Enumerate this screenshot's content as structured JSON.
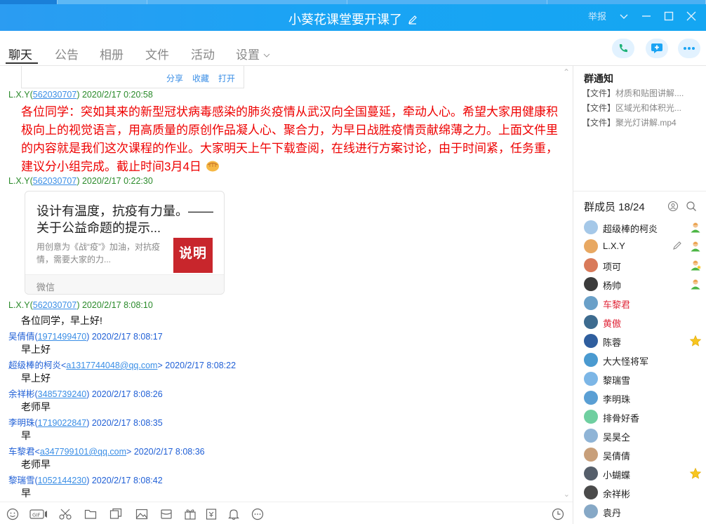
{
  "window": {
    "title": "小葵花课堂要开课了",
    "report_label": "举报"
  },
  "tabs": [
    {
      "label": "聊天",
      "active": true
    },
    {
      "label": "公告"
    },
    {
      "label": "相册"
    },
    {
      "label": "文件"
    },
    {
      "label": "活动"
    },
    {
      "label": "设置"
    }
  ],
  "share_card": {
    "share": "分享",
    "collect": "收藏",
    "open": "打开"
  },
  "messages": [
    {
      "sender": "L.X.Y(",
      "qq": "562030707",
      "close": ")",
      "time": "2020/2/17 0:20:58"
    },
    {
      "sender": "L.X.Y(",
      "qq": "562030707",
      "close": ")",
      "time": "2020/2/17 0:22:30"
    },
    {
      "sender": "L.X.Y(",
      "qq": "562030707",
      "close": ")",
      "time": "2020/2/17 8:08:10",
      "text": "各位同学，早上好!"
    },
    {
      "sender": "吴倩倩(",
      "qq": "1971499470",
      "close": ")",
      "time": "2020/2/17 8:08:17",
      "text": "早上好"
    },
    {
      "sender": "超级棒的柯炎<",
      "qq": "a1317744048@qq.com",
      "close": ">",
      "time": "2020/2/17 8:08:22",
      "text": "早上好"
    },
    {
      "sender": "余祥彬(",
      "qq": "3485739240",
      "close": ")",
      "time": "2020/2/17 8:08:26",
      "text": "老师早"
    },
    {
      "sender": "李明珠(",
      "qq": "1719022847",
      "close": ")",
      "time": "2020/2/17 8:08:35",
      "text": "早"
    },
    {
      "sender": "车黎君<",
      "qq": "a347799101@qq.com",
      "close": ">",
      "time": "2020/2/17 8:08:36",
      "text": "老师早"
    },
    {
      "sender": "黎瑞雪(",
      "qq": "1052144230",
      "close": ")",
      "time": "2020/2/17 8:08:42",
      "text": "早"
    }
  ],
  "announcement": "各位同学：突如其来的新型冠状病毒感染的肺炎疫情从武汉向全国蔓延，牵动人心。希望大家用健康积极向上的视觉语言，用高质量的原创作品凝人心、聚合力，为早日战胜疫情贡献绵薄之力。上面文件里的内容就是我们这次课程的作业。大家明天上午下载查阅，在线进行方案讨论，由于时间紧，任务重，建议分小组完成。截止时间3月4日",
  "link_card": {
    "title": "设计有温度，抗疫有力量。——关于公益命题的提示...",
    "desc": "用创意为《战“疫”》加油，对抗疫情，需要大家的力...",
    "thumb_text": "说明",
    "source": "微信"
  },
  "group_notice": {
    "title": "群通知",
    "items": [
      {
        "tag": "【文件】",
        "name": "材质和贴图讲解...."
      },
      {
        "tag": "【文件】",
        "name": "区域光和体积光..."
      },
      {
        "tag": "【文件】",
        "name": "聚光灯讲解.mp4"
      }
    ]
  },
  "members": {
    "title": "群成员 18/24",
    "list": [
      {
        "name": "超级棒的柯炎",
        "badge": "admin-green",
        "color": "#a5c8e8"
      },
      {
        "name": "L.X.Y",
        "badge": "admin-green",
        "edit": true,
        "color": "#e8a862"
      },
      {
        "name": "项可",
        "badge": "admin-star",
        "color": "#d97a5a"
      },
      {
        "name": "杨帅",
        "badge": "admin-green",
        "color": "#3b3b3b"
      },
      {
        "name": "车黎君",
        "red": true,
        "color": "#6aa0c8"
      },
      {
        "name": "黄傲",
        "red": true,
        "color": "#3d6b8f"
      },
      {
        "name": "陈蓉",
        "badge": "star",
        "color": "#2f5e9e"
      },
      {
        "name": "大大怪将军",
        "color": "#4a9ad0"
      },
      {
        "name": "黎瑞雪",
        "color": "#7cb6e6"
      },
      {
        "name": "李明珠",
        "color": "#5a9fd4"
      },
      {
        "name": "排骨好香",
        "color": "#6fcfa0"
      },
      {
        "name": "吴昊仝",
        "color": "#8fb4d6"
      },
      {
        "name": "吴倩倩",
        "color": "#c89f7a"
      },
      {
        "name": "小蝴蝶",
        "badge": "star",
        "color": "#555e6a"
      },
      {
        "name": "余祥彬",
        "color": "#4a4a4a"
      },
      {
        "name": "袁丹",
        "color": "#86a8c6"
      }
    ]
  },
  "colors": {
    "accent": "#1aa4f4",
    "announce": "#e00000",
    "qq_link": "#3a8ee6"
  }
}
